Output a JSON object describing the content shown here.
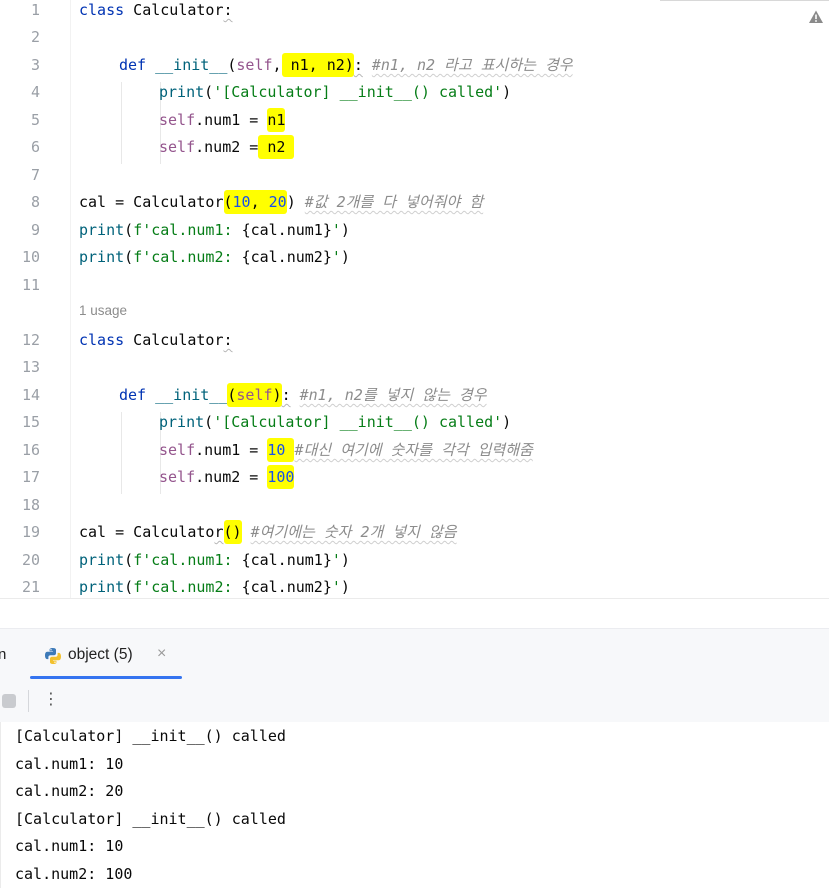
{
  "editor": {
    "inlay_hint": "1 usage",
    "lines": [
      {
        "num": "1",
        "code": "class Calculator:"
      },
      {
        "num": "2",
        "code": ""
      },
      {
        "num": "3",
        "code": "    def __init__(self, n1, n2): #n1, n2 라고 표시하는 경우"
      },
      {
        "num": "4",
        "code": "        print('[Calculator] __init__() called')"
      },
      {
        "num": "5",
        "code": "        self.num1 = n1"
      },
      {
        "num": "6",
        "code": "        self.num2 = n2"
      },
      {
        "num": "7",
        "code": ""
      },
      {
        "num": "8",
        "code": "cal = Calculator(10, 20) #값 2개를 다 넣어줘야 함"
      },
      {
        "num": "9",
        "code": "print(f'cal.num1: {cal.num1}')"
      },
      {
        "num": "10",
        "code": "print(f'cal.num2: {cal.num2}')"
      },
      {
        "num": "11",
        "code": ""
      },
      {
        "num": "12",
        "code": "class Calculator:"
      },
      {
        "num": "13",
        "code": ""
      },
      {
        "num": "14",
        "code": "    def __init__(self): #n1, n2를 넣지 않는 경우"
      },
      {
        "num": "15",
        "code": "        print('[Calculator] __init__() called')"
      },
      {
        "num": "16",
        "code": "        self.num1 = 10 #대신 여기에 숫자를 각각 입력해줌"
      },
      {
        "num": "17",
        "code": "        self.num2 = 100"
      },
      {
        "num": "18",
        "code": ""
      },
      {
        "num": "19",
        "code": "cal = Calculator() #여기에는 숫자 2개 넣지 않음"
      },
      {
        "num": "20",
        "code": "print(f'cal.num1: {cal.num1}')"
      },
      {
        "num": "21",
        "code": "print(f'cal.num2: {cal.num2}')"
      }
    ]
  },
  "run_panel": {
    "partial_tab": "n",
    "tab_label": "object (5)",
    "tab_close": "×",
    "more_glyph": "⋮"
  },
  "console": {
    "lines": [
      "[Calculator] __init__() called",
      "cal.num1: 10",
      "cal.num2: 20",
      "[Calculator] __init__() called",
      "cal.num1: 10",
      "cal.num2: 100"
    ]
  },
  "colors": {
    "highlight": "#ffff00",
    "keyword": "#0033b3",
    "function": "#00627a",
    "self": "#94558d",
    "string": "#067d17",
    "number": "#1750eb",
    "comment": "#8c8c8c",
    "tab_underline": "#3574f0"
  }
}
